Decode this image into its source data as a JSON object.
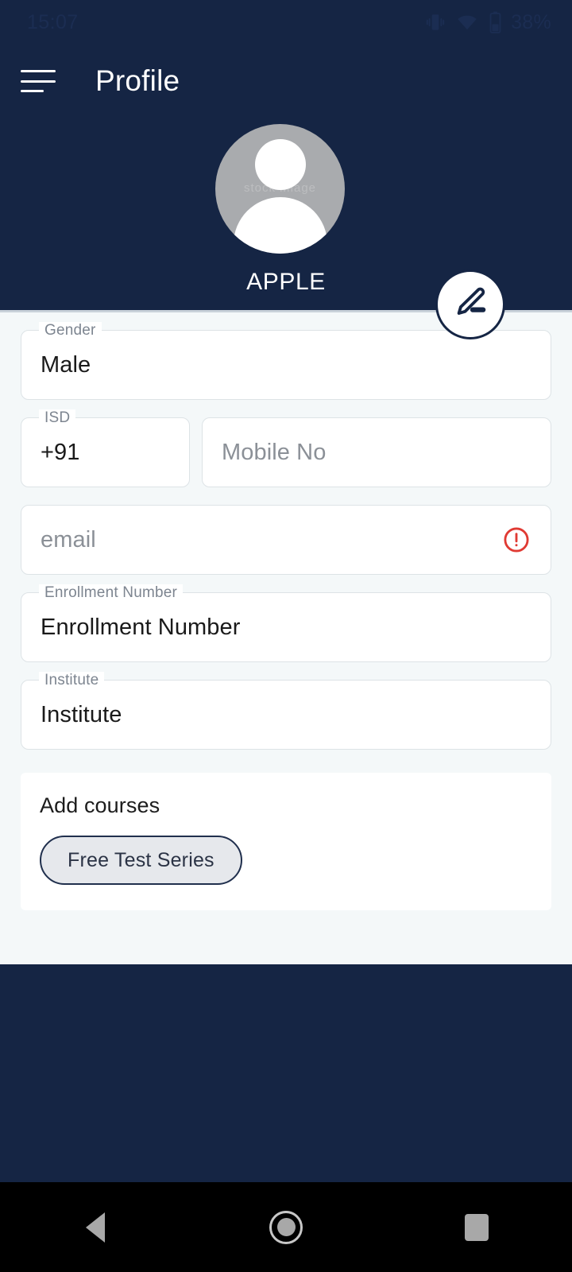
{
  "status_bar": {
    "time": "15:07",
    "battery_percent": "38%",
    "icons": [
      "vibrate-icon",
      "wifi-icon",
      "battery-icon"
    ]
  },
  "app_bar": {
    "menu_icon": "hamburger-menu-icon",
    "title": "Profile"
  },
  "header": {
    "avatar_icon": "default-user-avatar",
    "avatar_watermark": "stock image",
    "profile_name": "APPLE",
    "edit_button_icon": "pencil-edit-icon"
  },
  "form": {
    "gender": {
      "label": "Gender",
      "value": "Male",
      "placeholder": "Gender"
    },
    "isd": {
      "label": "ISD",
      "value": "+91",
      "placeholder": "ISD"
    },
    "mobile": {
      "label": "",
      "value": "",
      "placeholder": "Mobile No"
    },
    "email": {
      "label": "",
      "value": "",
      "placeholder": "email",
      "error_icon": "error-exclamation-icon"
    },
    "enrollment": {
      "label": "Enrollment Number",
      "value": "Enrollment Number",
      "placeholder": "Enrollment Number"
    },
    "institute": {
      "label": "Institute",
      "value": "Institute",
      "placeholder": "Institute"
    }
  },
  "courses": {
    "title": "Add courses",
    "chips": [
      {
        "label": "Free Test Series"
      }
    ]
  },
  "nav_bar": {
    "back": "back-triangle-icon",
    "home": "home-circle-icon",
    "recents": "recents-square-icon"
  },
  "colors": {
    "navy": "#152544",
    "content_bg": "#f4f8f9",
    "error_red": "#e03a33",
    "chip_fill": "#e6e8ec",
    "field_border": "#dde3e6",
    "avatar_gray": "#a9abae"
  }
}
